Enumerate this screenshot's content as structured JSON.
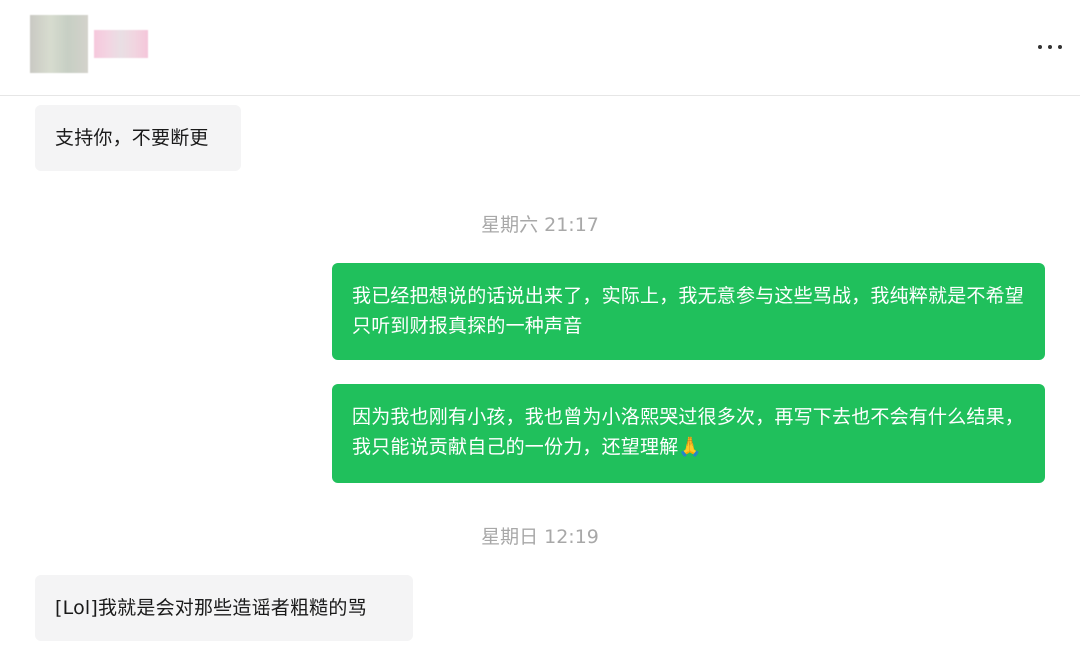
{
  "header": {
    "more_icon": "more-horizontal-icon"
  },
  "messages": [
    {
      "direction": "in",
      "text": "支持你，不要断更"
    },
    {
      "direction": "out",
      "text": "我已经把想说的话说出来了，实际上，我无意参与这些骂战，我纯粹就是不希望只听到财报真探的一种声音"
    },
    {
      "direction": "out",
      "text": "因为我也刚有小孩，我也曾为小洛熙哭过很多次，再写下去也不会有什么结果，我只能说贡献自己的一份力，还望理解🙏"
    },
    {
      "direction": "in",
      "text": "[Lol]我就是会对那些造谣者粗糙的骂"
    }
  ],
  "timestamps": [
    "星期六 21:17",
    "星期日 12:19"
  ],
  "colors": {
    "outgoing_bubble": "#20c05c",
    "incoming_bubble": "#f4f4f5",
    "timestamp_text": "#a8a8a8"
  }
}
